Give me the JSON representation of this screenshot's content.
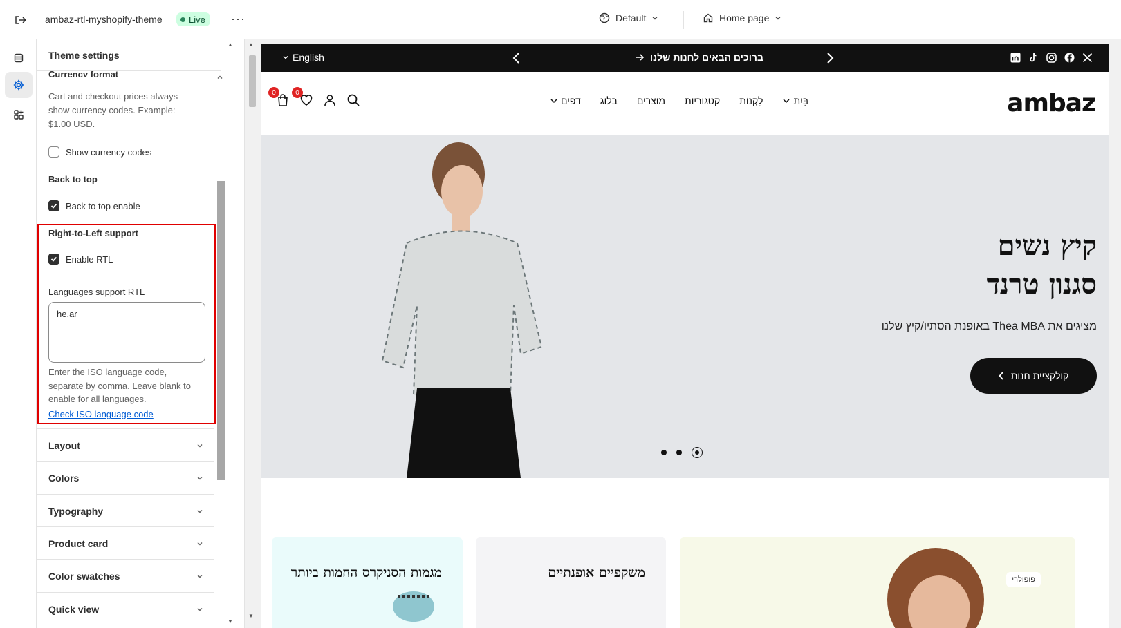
{
  "topbar": {
    "theme_name": "ambaz-rtl-myshopify-theme",
    "live_label": "Live",
    "more_label": "···",
    "view_selector": "Default",
    "page_selector": "Home page"
  },
  "rail": {
    "items": [
      {
        "icon": "sections-icon"
      },
      {
        "icon": "settings-gear-icon",
        "active": true
      },
      {
        "icon": "apps-icon"
      }
    ]
  },
  "panel": {
    "title": "Theme settings",
    "currency_section_title": "Currency format",
    "currency_help": "Cart and checkout prices always show currency codes. Example: $1.00 USD.",
    "show_currency_codes": {
      "label": "Show currency codes",
      "checked": false
    },
    "back_to_top_heading": "Back to top",
    "back_to_top_enable": {
      "label": "Back to top enable",
      "checked": true
    },
    "rtl_heading": "Right-to-Left support",
    "enable_rtl": {
      "label": "Enable RTL",
      "checked": true
    },
    "languages_label": "Languages support RTL",
    "languages_value": "he,ar",
    "languages_help": "Enter the ISO language code, separate by comma. Leave blank to enable for all languages.",
    "iso_link": "Check ISO language code",
    "accordions": [
      "Layout",
      "Colors",
      "Typography",
      "Product card",
      "Color swatches",
      "Quick view"
    ]
  },
  "preview": {
    "announcement": {
      "language": "English",
      "message": "ברוכים הבאים לחנות שלנו",
      "socials": [
        "linkedin-icon",
        "tiktok-icon",
        "instagram-icon",
        "facebook-icon",
        "x-icon"
      ]
    },
    "header": {
      "logo": "ambaz",
      "nav": [
        "בַּיִת",
        "לִקְנוֹת",
        "קטגוריות",
        "מוצרים",
        "בלוג",
        "דפים"
      ],
      "cart_count": "0",
      "wishlist_count": "0"
    },
    "hero": {
      "title_line1": "קיץ נשים",
      "title_line2": "סגנון טרנד",
      "subtitle": "מציגים את Thea MBA באופנת הסתיו/קיץ שלנו",
      "button": "קולקציית חנות",
      "slides": 3,
      "active_slide": 3
    },
    "cards": [
      {
        "title": "מגמות הסניקרס החמות ביותר"
      },
      {
        "title": "משקפיים אופנתיים"
      },
      {
        "badge": "פופולרי"
      }
    ]
  }
}
